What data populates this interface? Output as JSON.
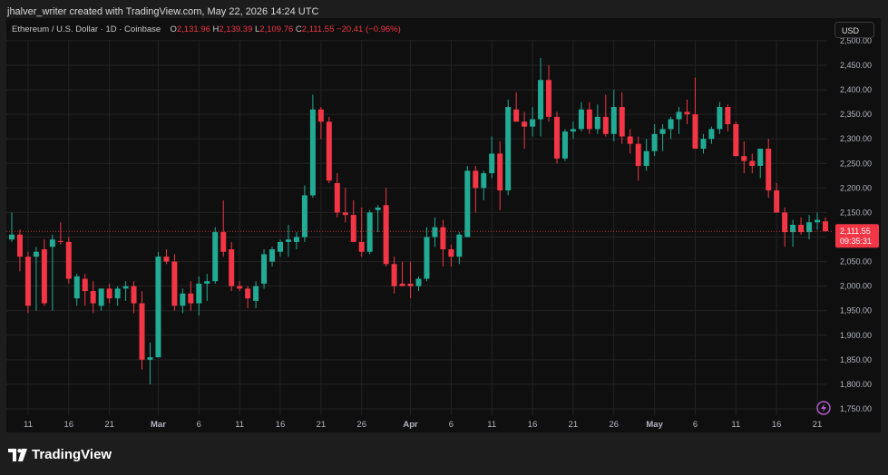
{
  "caption": "jhalver_writer created with TradingView.com, May 22, 2026 14:24 UTC",
  "legend": {
    "symbol": "Ethereum / U.S. Dollar · 1D · Coinbase",
    "open_key": "O",
    "open": "2,131.96",
    "high_key": "H",
    "high": "2,139.39",
    "low_key": "L",
    "low": "2,109.76",
    "close_key": "C",
    "close": "2,111.55",
    "change": "−20.41 (−0.96%)"
  },
  "currency_button": "USD",
  "price_tag": {
    "price": "2,111.55",
    "countdown": "09:35:31"
  },
  "footer": {
    "logo_text": "TradingView",
    "logo_icon": "tradingview-logo-icon"
  },
  "colors": {
    "up": "#22ab94",
    "down": "#f23645",
    "grid": "#232323",
    "text": "#b2b5be",
    "background": "#0f0f0f"
  },
  "chart_data": {
    "type": "candlestick",
    "title": "Ethereum / U.S. Dollar · 1D · Coinbase",
    "y_axis": {
      "min": 1750,
      "max": 2500,
      "ticks": [
        "2,500.00",
        "2,450.00",
        "2,400.00",
        "2,350.00",
        "2,300.00",
        "2,250.00",
        "2,200.00",
        "2,150.00",
        "2,100.00",
        "2,050.00",
        "2,000.00",
        "1,950.00",
        "1,900.00",
        "1,850.00",
        "1,800.00",
        "1,750.00"
      ],
      "tick_values": [
        2500,
        2450,
        2400,
        2350,
        2300,
        2250,
        2200,
        2150,
        2100,
        2050,
        2000,
        1950,
        1900,
        1850,
        1800,
        1750
      ]
    },
    "x_axis": {
      "labels": [
        "11",
        "16",
        "21",
        "Mar",
        "6",
        "11",
        "16",
        "21",
        "26",
        "Apr",
        "6",
        "11",
        "16",
        "21",
        "26",
        "May",
        "6",
        "11",
        "16",
        "21"
      ],
      "label_indices": [
        2,
        7,
        12,
        18,
        23,
        28,
        33,
        38,
        43,
        49,
        54,
        59,
        64,
        69,
        74,
        79,
        84,
        89,
        94,
        99
      ],
      "bold": [
        "Mar",
        "Apr",
        "May"
      ]
    },
    "last_price": 2111.55,
    "candles": [
      [
        2095,
        2150,
        2090,
        2105
      ],
      [
        2105,
        2115,
        2030,
        2060
      ],
      [
        2060,
        2070,
        1945,
        1960
      ],
      [
        2060,
        2080,
        1950,
        2070
      ],
      [
        2075,
        2095,
        1960,
        1965
      ],
      [
        2080,
        2105,
        1950,
        2095
      ],
      [
        2092,
        2130,
        2085,
        2090
      ],
      [
        2090,
        2100,
        2005,
        2015
      ],
      [
        1975,
        2025,
        1960,
        2020
      ],
      [
        2015,
        2025,
        1960,
        1990
      ],
      [
        1990,
        2010,
        1945,
        1965
      ],
      [
        1960,
        1995,
        1950,
        1995
      ],
      [
        1995,
        2005,
        1965,
        1975
      ],
      [
        1975,
        2000,
        1960,
        1995
      ],
      [
        1995,
        2010,
        1970,
        2000
      ],
      [
        2000,
        2010,
        1945,
        1965
      ],
      [
        1965,
        1990,
        1830,
        1850
      ],
      [
        1850,
        1885,
        1800,
        1855
      ],
      [
        1855,
        2070,
        1855,
        2060
      ],
      [
        2060,
        2075,
        2045,
        2050
      ],
      [
        2050,
        2065,
        1950,
        1960
      ],
      [
        1960,
        1995,
        1945,
        1985
      ],
      [
        1985,
        2010,
        1950,
        1965
      ],
      [
        1965,
        2020,
        1940,
        2005
      ],
      [
        2005,
        2025,
        1970,
        2010
      ],
      [
        2010,
        2120,
        2005,
        2110
      ],
      [
        2110,
        2175,
        2060,
        2070
      ],
      [
        2075,
        2090,
        1990,
        2000
      ],
      [
        2000,
        2010,
        1990,
        1995
      ],
      [
        1995,
        2000,
        1955,
        1975
      ],
      [
        1970,
        2010,
        1955,
        2000
      ],
      [
        2005,
        2075,
        1995,
        2065
      ],
      [
        2050,
        2080,
        2040,
        2075
      ],
      [
        2070,
        2095,
        2060,
        2090
      ],
      [
        2090,
        2125,
        2060,
        2095
      ],
      [
        2090,
        2110,
        2075,
        2100
      ],
      [
        2100,
        2205,
        2090,
        2185
      ],
      [
        2185,
        2390,
        2180,
        2360
      ],
      [
        2360,
        2365,
        2300,
        2335
      ],
      [
        2335,
        2345,
        2210,
        2215
      ],
      [
        2210,
        2230,
        2140,
        2150
      ],
      [
        2150,
        2200,
        2130,
        2145
      ],
      [
        2145,
        2175,
        2090,
        2090
      ],
      [
        2090,
        2160,
        2060,
        2070
      ],
      [
        2070,
        2155,
        2065,
        2150
      ],
      [
        2155,
        2165,
        2110,
        2160
      ],
      [
        2165,
        2200,
        2040,
        2045
      ],
      [
        2045,
        2060,
        1985,
        2000
      ],
      [
        2005,
        2050,
        2000,
        2000
      ],
      [
        2005,
        2050,
        1975,
        2000
      ],
      [
        2000,
        2020,
        1990,
        2015
      ],
      [
        2015,
        2120,
        2010,
        2100
      ],
      [
        2100,
        2140,
        2080,
        2120
      ],
      [
        2120,
        2135,
        2040,
        2075
      ],
      [
        2075,
        2085,
        2040,
        2060
      ],
      [
        2060,
        2110,
        2045,
        2105
      ],
      [
        2100,
        2245,
        2100,
        2235
      ],
      [
        2235,
        2245,
        2150,
        2200
      ],
      [
        2200,
        2235,
        2175,
        2230
      ],
      [
        2230,
        2305,
        2220,
        2270
      ],
      [
        2270,
        2295,
        2155,
        2195
      ],
      [
        2195,
        2380,
        2185,
        2365
      ],
      [
        2360,
        2395,
        2340,
        2335
      ],
      [
        2335,
        2355,
        2280,
        2325
      ],
      [
        2325,
        2365,
        2305,
        2340
      ],
      [
        2340,
        2465,
        2305,
        2420
      ],
      [
        2420,
        2450,
        2335,
        2345
      ],
      [
        2345,
        2355,
        2250,
        2260
      ],
      [
        2260,
        2320,
        2255,
        2315
      ],
      [
        2315,
        2335,
        2300,
        2320
      ],
      [
        2320,
        2375,
        2315,
        2360
      ],
      [
        2360,
        2375,
        2310,
        2320
      ],
      [
        2320,
        2370,
        2310,
        2345
      ],
      [
        2345,
        2390,
        2305,
        2310
      ],
      [
        2310,
        2400,
        2295,
        2365
      ],
      [
        2365,
        2395,
        2290,
        2305
      ],
      [
        2305,
        2320,
        2270,
        2290
      ],
      [
        2290,
        2305,
        2215,
        2245
      ],
      [
        2245,
        2300,
        2235,
        2275
      ],
      [
        2275,
        2330,
        2265,
        2310
      ],
      [
        2310,
        2330,
        2275,
        2320
      ],
      [
        2320,
        2345,
        2300,
        2340
      ],
      [
        2340,
        2365,
        2310,
        2355
      ],
      [
        2355,
        2380,
        2330,
        2350
      ],
      [
        2350,
        2425,
        2280,
        2280
      ],
      [
        2280,
        2310,
        2270,
        2300
      ],
      [
        2300,
        2325,
        2290,
        2320
      ],
      [
        2320,
        2375,
        2310,
        2365
      ],
      [
        2365,
        2370,
        2315,
        2330
      ],
      [
        2330,
        2335,
        2265,
        2265
      ],
      [
        2265,
        2295,
        2230,
        2255
      ],
      [
        2255,
        2270,
        2230,
        2245
      ],
      [
        2245,
        2275,
        2220,
        2280
      ],
      [
        2280,
        2300,
        2180,
        2195
      ],
      [
        2195,
        2210,
        2150,
        2150
      ],
      [
        2150,
        2160,
        2080,
        2110
      ],
      [
        2110,
        2135,
        2080,
        2125
      ],
      [
        2125,
        2140,
        2105,
        2110
      ],
      [
        2110,
        2145,
        2095,
        2130
      ],
      [
        2130,
        2150,
        2115,
        2135
      ],
      [
        2132,
        2140,
        2110,
        2112
      ]
    ]
  }
}
